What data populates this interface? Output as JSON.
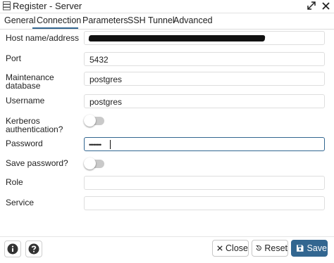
{
  "window": {
    "title": "Register - Server",
    "icons": [
      "server-icon",
      "maximize-icon",
      "close-icon"
    ]
  },
  "tabs": [
    "General",
    "Connection",
    "Parameters",
    "SSH Tunnel",
    "Advanced"
  ],
  "active_tab": "Connection",
  "form": {
    "host_label": "Host name/address",
    "host_value_redacted": true,
    "port_label": "Port",
    "port_value": "5432",
    "maintenance_label_line1": "Maintenance",
    "maintenance_label_line2": "database",
    "maintenance_value": "postgres",
    "username_label": "Username",
    "username_value": "postgres",
    "kerberos_label_line1": "Kerberos",
    "kerberos_label_line2": "authentication?",
    "kerberos_enabled": false,
    "password_label": "Password",
    "password_value": "••••••••",
    "save_password_label": "Save password?",
    "save_password_enabled": false,
    "role_label": "Role",
    "role_value": "",
    "service_label": "Service",
    "service_value": ""
  },
  "footer": {
    "info_icon": "info-icon",
    "help_icon": "help-icon",
    "close_label": "Close",
    "reset_label": "Reset",
    "save_label": "Save"
  },
  "colors": {
    "accent": "#326690",
    "toggle_off": "#c9c9c9"
  }
}
